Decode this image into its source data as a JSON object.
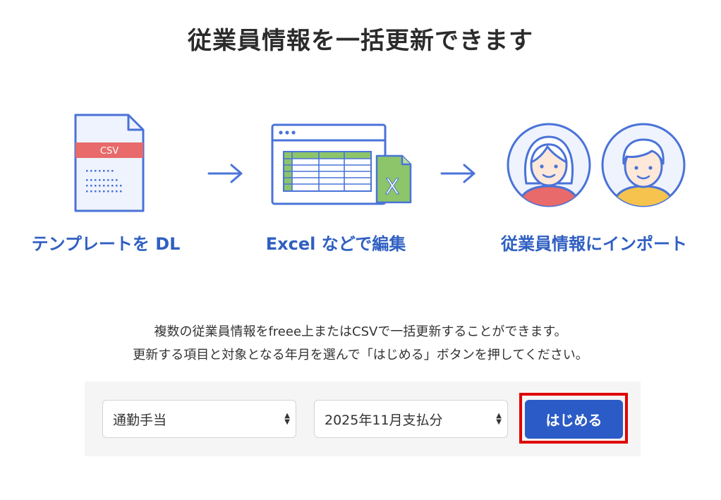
{
  "title": "従業員情報を一括更新できます",
  "steps": [
    {
      "label": "テンプレートを DL",
      "icon_text": "CSV"
    },
    {
      "label": "Excel などで編集",
      "icon_text": "X"
    },
    {
      "label": "従業員情報にインポート"
    }
  ],
  "description": {
    "line1": "複数の従業員情報をfreee上またはCSVで一括更新することができます。",
    "line2": "更新する項目と対象となる年月を選んで「はじめる」ボタンを押してください。"
  },
  "controls": {
    "item_select": {
      "value": "通勤手当"
    },
    "period_select": {
      "value": "2025年11月支払分"
    },
    "start_button": {
      "label": "はじめる"
    }
  },
  "colors": {
    "accent_blue": "#2b5bc6",
    "label_blue": "#2f5fc2",
    "icon_blue": "#4a73d8",
    "csv_red": "#e86a6a",
    "excel_green": "#8cc56a",
    "highlight_red": "#e00000"
  }
}
